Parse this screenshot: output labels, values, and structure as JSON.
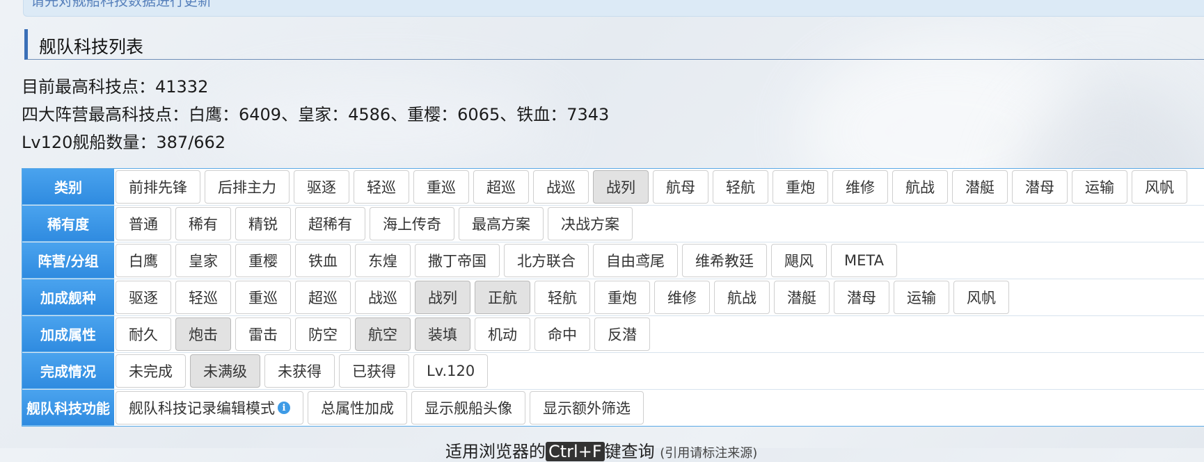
{
  "banner": {
    "text": "请先对舰船科技数据进行更新"
  },
  "section_title": "舰队科技列表",
  "info": {
    "max_tech": "目前最高科技点：41332",
    "faction_tech": "四大阵营最高科技点：白鹰：6409、皇家：4586、重樱：6065、铁血：7343",
    "lv120_count": "Lv120舰船数量：387/662"
  },
  "filters": [
    {
      "label": "类别",
      "items": [
        "前排先锋",
        "后排主力",
        "驱逐",
        "轻巡",
        "重巡",
        "超巡",
        "战巡",
        "战列",
        "航母",
        "轻航",
        "重炮",
        "维修",
        "航战",
        "潜艇",
        "潜母",
        "运输",
        "风帆"
      ],
      "active": [
        "战列"
      ]
    },
    {
      "label": "稀有度",
      "items": [
        "普通",
        "稀有",
        "精锐",
        "超稀有",
        "海上传奇",
        "最高方案",
        "决战方案"
      ],
      "active": []
    },
    {
      "label": "阵营/分组",
      "items": [
        "白鹰",
        "皇家",
        "重樱",
        "铁血",
        "东煌",
        "撒丁帝国",
        "北方联合",
        "自由鸢尾",
        "维希教廷",
        "飓风",
        "META"
      ],
      "active": []
    },
    {
      "label": "加成舰种",
      "items": [
        "驱逐",
        "轻巡",
        "重巡",
        "超巡",
        "战巡",
        "战列",
        "正航",
        "轻航",
        "重炮",
        "维修",
        "航战",
        "潜艇",
        "潜母",
        "运输",
        "风帆"
      ],
      "active": [
        "战列",
        "正航"
      ]
    },
    {
      "label": "加成属性",
      "items": [
        "耐久",
        "炮击",
        "雷击",
        "防空",
        "航空",
        "装填",
        "机动",
        "命中",
        "反潜"
      ],
      "active": [
        "炮击",
        "航空",
        "装填"
      ]
    },
    {
      "label": "完成情况",
      "items": [
        "未完成",
        "未满级",
        "未获得",
        "已获得",
        "Lv.120"
      ],
      "active": [
        "未满级"
      ]
    },
    {
      "label": "舰队科技功能",
      "items": [
        "舰队科技记录编辑模式",
        "总属性加成",
        "显示舰船头像",
        "显示额外筛选"
      ],
      "active": []
    }
  ],
  "info_icon": "info-circle-icon",
  "bottom": {
    "prefix": "适用浏览器的",
    "key": "Ctrl+F",
    "suffix": "键查询",
    "note": "(引用请标注来源)"
  }
}
